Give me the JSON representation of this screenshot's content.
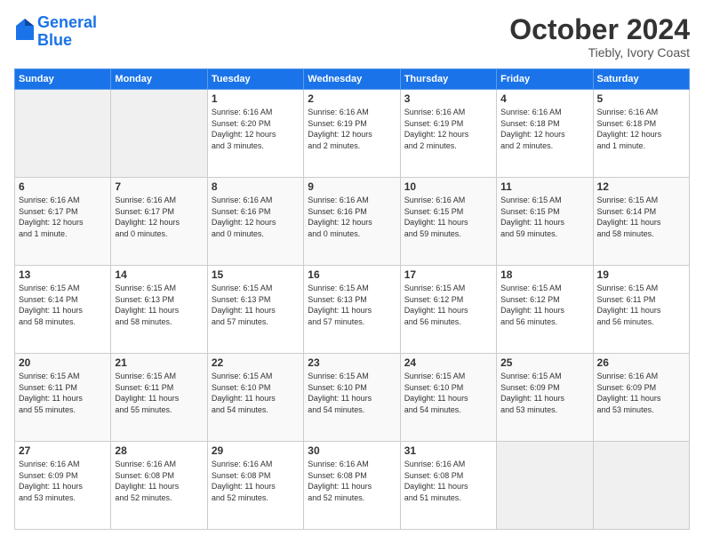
{
  "header": {
    "logo_line1": "General",
    "logo_line2": "Blue",
    "title": "October 2024",
    "subtitle": "Tiebly, Ivory Coast"
  },
  "weekdays": [
    "Sunday",
    "Monday",
    "Tuesday",
    "Wednesday",
    "Thursday",
    "Friday",
    "Saturday"
  ],
  "weeks": [
    [
      {
        "day": "",
        "info": ""
      },
      {
        "day": "",
        "info": ""
      },
      {
        "day": "1",
        "info": "Sunrise: 6:16 AM\nSunset: 6:20 PM\nDaylight: 12 hours\nand 3 minutes."
      },
      {
        "day": "2",
        "info": "Sunrise: 6:16 AM\nSunset: 6:19 PM\nDaylight: 12 hours\nand 2 minutes."
      },
      {
        "day": "3",
        "info": "Sunrise: 6:16 AM\nSunset: 6:19 PM\nDaylight: 12 hours\nand 2 minutes."
      },
      {
        "day": "4",
        "info": "Sunrise: 6:16 AM\nSunset: 6:18 PM\nDaylight: 12 hours\nand 2 minutes."
      },
      {
        "day": "5",
        "info": "Sunrise: 6:16 AM\nSunset: 6:18 PM\nDaylight: 12 hours\nand 1 minute."
      }
    ],
    [
      {
        "day": "6",
        "info": "Sunrise: 6:16 AM\nSunset: 6:17 PM\nDaylight: 12 hours\nand 1 minute."
      },
      {
        "day": "7",
        "info": "Sunrise: 6:16 AM\nSunset: 6:17 PM\nDaylight: 12 hours\nand 0 minutes."
      },
      {
        "day": "8",
        "info": "Sunrise: 6:16 AM\nSunset: 6:16 PM\nDaylight: 12 hours\nand 0 minutes."
      },
      {
        "day": "9",
        "info": "Sunrise: 6:16 AM\nSunset: 6:16 PM\nDaylight: 12 hours\nand 0 minutes."
      },
      {
        "day": "10",
        "info": "Sunrise: 6:16 AM\nSunset: 6:15 PM\nDaylight: 11 hours\nand 59 minutes."
      },
      {
        "day": "11",
        "info": "Sunrise: 6:15 AM\nSunset: 6:15 PM\nDaylight: 11 hours\nand 59 minutes."
      },
      {
        "day": "12",
        "info": "Sunrise: 6:15 AM\nSunset: 6:14 PM\nDaylight: 11 hours\nand 58 minutes."
      }
    ],
    [
      {
        "day": "13",
        "info": "Sunrise: 6:15 AM\nSunset: 6:14 PM\nDaylight: 11 hours\nand 58 minutes."
      },
      {
        "day": "14",
        "info": "Sunrise: 6:15 AM\nSunset: 6:13 PM\nDaylight: 11 hours\nand 58 minutes."
      },
      {
        "day": "15",
        "info": "Sunrise: 6:15 AM\nSunset: 6:13 PM\nDaylight: 11 hours\nand 57 minutes."
      },
      {
        "day": "16",
        "info": "Sunrise: 6:15 AM\nSunset: 6:13 PM\nDaylight: 11 hours\nand 57 minutes."
      },
      {
        "day": "17",
        "info": "Sunrise: 6:15 AM\nSunset: 6:12 PM\nDaylight: 11 hours\nand 56 minutes."
      },
      {
        "day": "18",
        "info": "Sunrise: 6:15 AM\nSunset: 6:12 PM\nDaylight: 11 hours\nand 56 minutes."
      },
      {
        "day": "19",
        "info": "Sunrise: 6:15 AM\nSunset: 6:11 PM\nDaylight: 11 hours\nand 56 minutes."
      }
    ],
    [
      {
        "day": "20",
        "info": "Sunrise: 6:15 AM\nSunset: 6:11 PM\nDaylight: 11 hours\nand 55 minutes."
      },
      {
        "day": "21",
        "info": "Sunrise: 6:15 AM\nSunset: 6:11 PM\nDaylight: 11 hours\nand 55 minutes."
      },
      {
        "day": "22",
        "info": "Sunrise: 6:15 AM\nSunset: 6:10 PM\nDaylight: 11 hours\nand 54 minutes."
      },
      {
        "day": "23",
        "info": "Sunrise: 6:15 AM\nSunset: 6:10 PM\nDaylight: 11 hours\nand 54 minutes."
      },
      {
        "day": "24",
        "info": "Sunrise: 6:15 AM\nSunset: 6:10 PM\nDaylight: 11 hours\nand 54 minutes."
      },
      {
        "day": "25",
        "info": "Sunrise: 6:15 AM\nSunset: 6:09 PM\nDaylight: 11 hours\nand 53 minutes."
      },
      {
        "day": "26",
        "info": "Sunrise: 6:16 AM\nSunset: 6:09 PM\nDaylight: 11 hours\nand 53 minutes."
      }
    ],
    [
      {
        "day": "27",
        "info": "Sunrise: 6:16 AM\nSunset: 6:09 PM\nDaylight: 11 hours\nand 53 minutes."
      },
      {
        "day": "28",
        "info": "Sunrise: 6:16 AM\nSunset: 6:08 PM\nDaylight: 11 hours\nand 52 minutes."
      },
      {
        "day": "29",
        "info": "Sunrise: 6:16 AM\nSunset: 6:08 PM\nDaylight: 11 hours\nand 52 minutes."
      },
      {
        "day": "30",
        "info": "Sunrise: 6:16 AM\nSunset: 6:08 PM\nDaylight: 11 hours\nand 52 minutes."
      },
      {
        "day": "31",
        "info": "Sunrise: 6:16 AM\nSunset: 6:08 PM\nDaylight: 11 hours\nand 51 minutes."
      },
      {
        "day": "",
        "info": ""
      },
      {
        "day": "",
        "info": ""
      }
    ]
  ]
}
